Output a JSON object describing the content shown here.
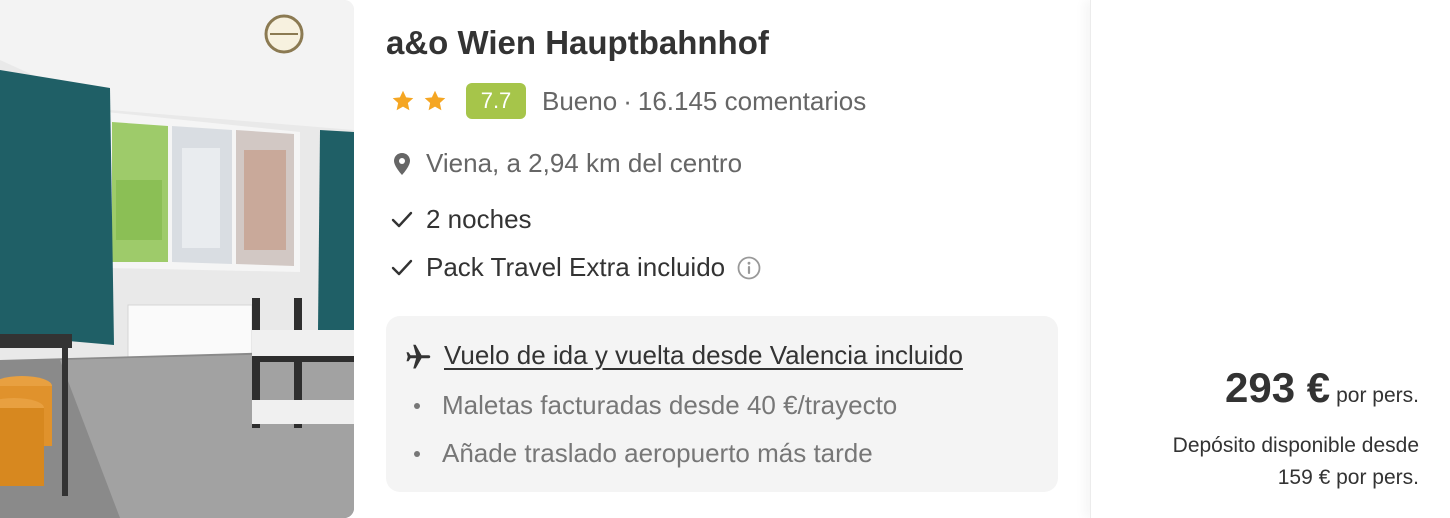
{
  "hotel": {
    "name": "a&o Wien Hauptbahnhof",
    "stars": 2,
    "score": "7.7",
    "rating_label": "Bueno",
    "separator": "·",
    "review_count": "16.145 comentarios",
    "location": "Viena, a 2,94 km del centro"
  },
  "features": {
    "nights": "2 noches",
    "pack": "Pack Travel Extra incluido"
  },
  "flight": {
    "main_label": "Vuelo de ida y vuelta desde Valencia incluido",
    "extras": [
      "Maletas facturadas desde 40 €/trayecto",
      "Añade traslado aeropuerto más tarde"
    ]
  },
  "price": {
    "amount": "293 €",
    "unit": "por pers.",
    "deposit_line1": "Depósito disponible desde",
    "deposit_line2": "159 € por pers."
  },
  "colors": {
    "score_badge": "#a6c54a",
    "star": "#f5a623",
    "text_dark": "#333333",
    "text_muted": "#666666",
    "flight_box_bg": "#f4f4f4"
  },
  "icons": {
    "star": "star-icon",
    "location": "map-pin-icon",
    "check": "check-icon",
    "info": "info-icon",
    "plane": "airplane-icon"
  }
}
